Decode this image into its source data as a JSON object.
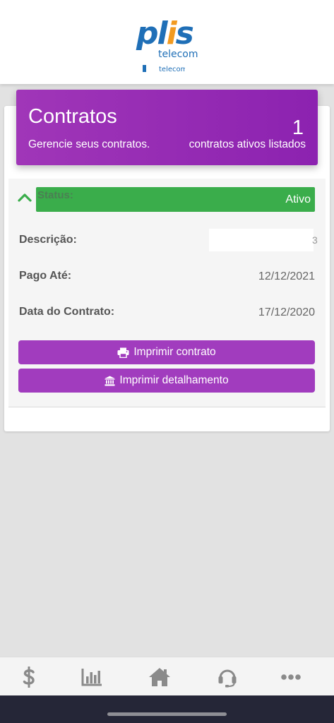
{
  "header": {
    "logo_main_pl": "pl",
    "logo_main_i": "i",
    "logo_main_s": "s",
    "logo_sub": "telecom"
  },
  "banner": {
    "title": "Contratos",
    "subtitle": "Gerencie seus contratos.",
    "count": "1",
    "count_label": "contratos ativos listados"
  },
  "contract": {
    "status_label": "Status:",
    "status_value": "Ativo",
    "description_label": "Descrição:",
    "description_value_tail": "3",
    "paid_until_label": "Pago Até:",
    "paid_until_value": "12/12/2021",
    "contract_date_label": "Data do Contrato:",
    "contract_date_value": "17/12/2020",
    "print_contract_label": "Imprimir contrato",
    "print_details_label": "Imprimir detalhamento"
  },
  "nav": {
    "items": [
      {
        "icon": "dollar-icon"
      },
      {
        "icon": "chart-icon"
      },
      {
        "icon": "home-icon"
      },
      {
        "icon": "support-icon"
      },
      {
        "icon": "more-icon"
      }
    ]
  },
  "colors": {
    "brand_purple": "#a13cbe",
    "status_green": "#3aad4b",
    "logo_blue": "#1f6fb7",
    "logo_orange": "#f29a1f",
    "nav_icon": "#8a8a8a"
  }
}
